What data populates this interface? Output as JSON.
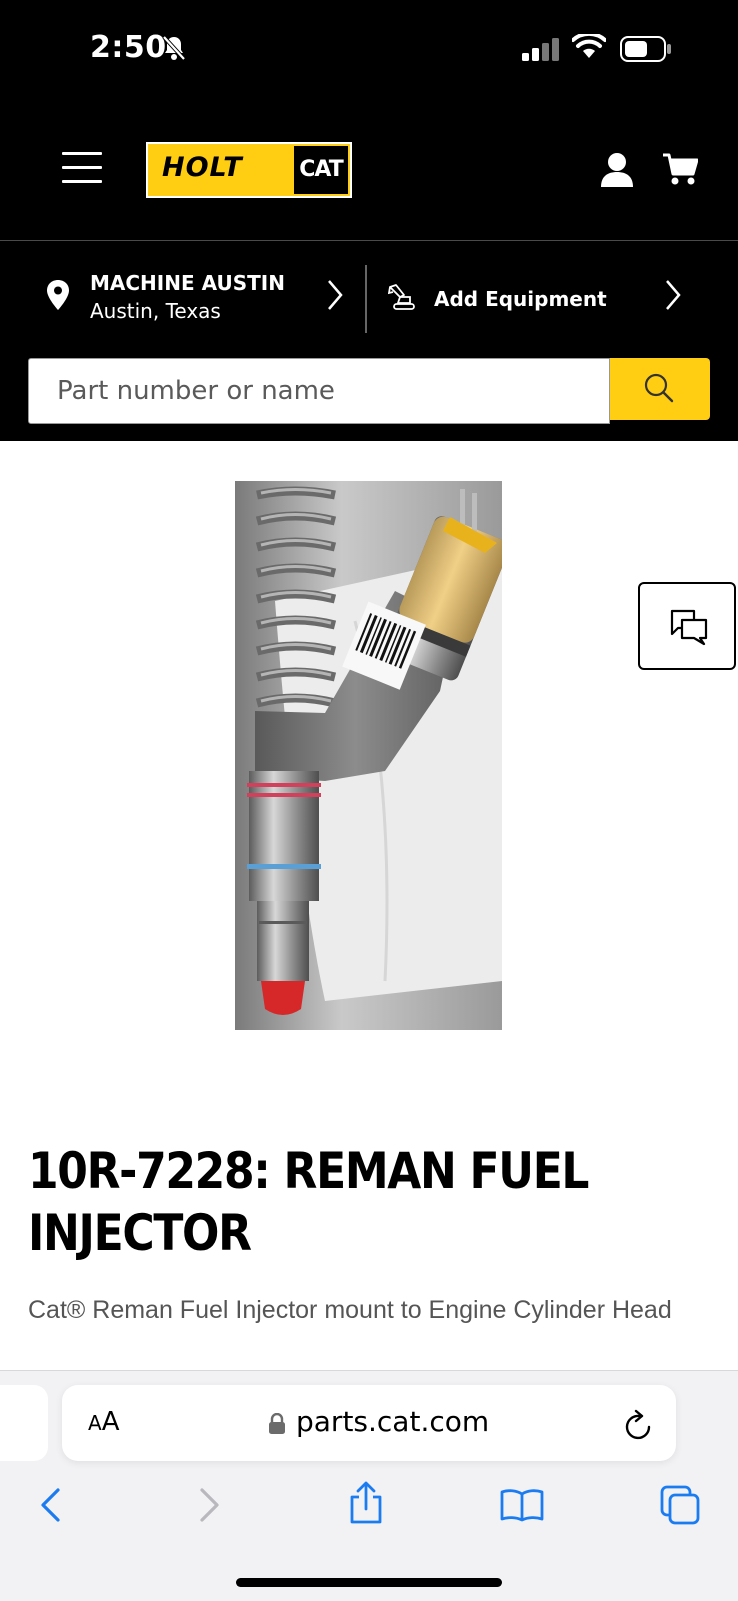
{
  "status_bar": {
    "time": "2:50"
  },
  "header": {
    "logo_holt": "HOLT",
    "logo_cat": "CAT"
  },
  "dealer": {
    "name": "MACHINE AUSTIN",
    "location": "Austin, Texas"
  },
  "equipment": {
    "label": "Add Equipment"
  },
  "search": {
    "placeholder": "Part number or name"
  },
  "product": {
    "title": "10R-7228: REMAN FUEL INJECTOR",
    "description": "Cat® Reman Fuel Injector mount to Engine Cylinder Head"
  },
  "browser": {
    "aa_small": "A",
    "aa_big": "A",
    "url": "parts.cat.com"
  },
  "colors": {
    "cat_yellow": "#ffcd11",
    "header_bg": "#000000",
    "safari_blue": "#1a7cf0"
  },
  "icons": [
    "bell-slash-icon",
    "signal-icon",
    "wifi-icon",
    "battery-icon",
    "menu-icon",
    "user-icon",
    "cart-icon",
    "location-pin-icon",
    "chevron-right-icon",
    "excavator-icon",
    "search-icon",
    "chat-icon",
    "lock-icon",
    "reload-icon",
    "back-icon",
    "forward-icon",
    "share-icon",
    "bookmarks-icon",
    "tabs-icon"
  ]
}
